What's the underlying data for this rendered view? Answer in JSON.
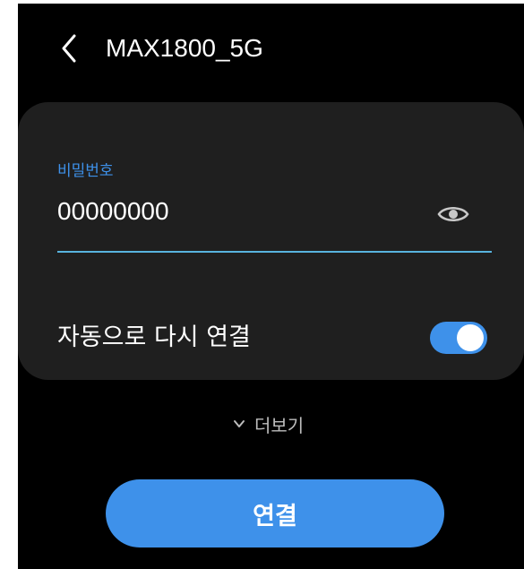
{
  "header": {
    "title": "MAX1800_5G",
    "back_icon": "chevron-left-icon"
  },
  "password": {
    "label": "비밀번호",
    "value": "00000000",
    "visibility_icon": "eye-icon"
  },
  "auto_reconnect": {
    "label": "자동으로 다시 연결",
    "enabled": true
  },
  "more": {
    "label": "더보기",
    "icon": "chevron-down-icon"
  },
  "connect_button": {
    "label": "연결"
  },
  "colors": {
    "background": "#000000",
    "card": "#1f1f1f",
    "accent": "#3e91ea",
    "underline": "#58b3de",
    "text": "#ffffff",
    "muted_text": "#bdbdbd"
  }
}
